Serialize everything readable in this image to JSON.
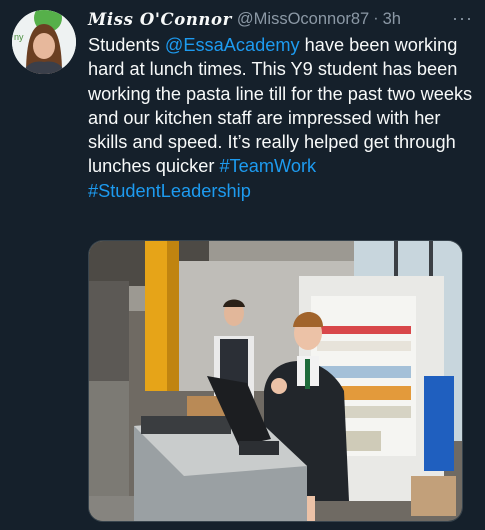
{
  "tweet": {
    "display_name": "Miss O'Connor",
    "handle": "@MissOconnor87",
    "separator": "·",
    "time": "3h",
    "more": "···",
    "text_parts": {
      "p1": "Students ",
      "mention": "@EssaAcademy",
      "p2": " have been working hard at lunch times. This Y9 student has been working the pasta line till for the past two weeks and our kitchen staff are impressed with her skills and speed. It’s really helped get through lunches quicker ",
      "hashtag1": "#TeamWork",
      "hashtag2": "#StudentLeadership"
    }
  },
  "avatar_logo_text": "ny",
  "colors": {
    "background": "#15202b",
    "link": "#1d9bf0",
    "secondary_text": "#8b98a5"
  }
}
